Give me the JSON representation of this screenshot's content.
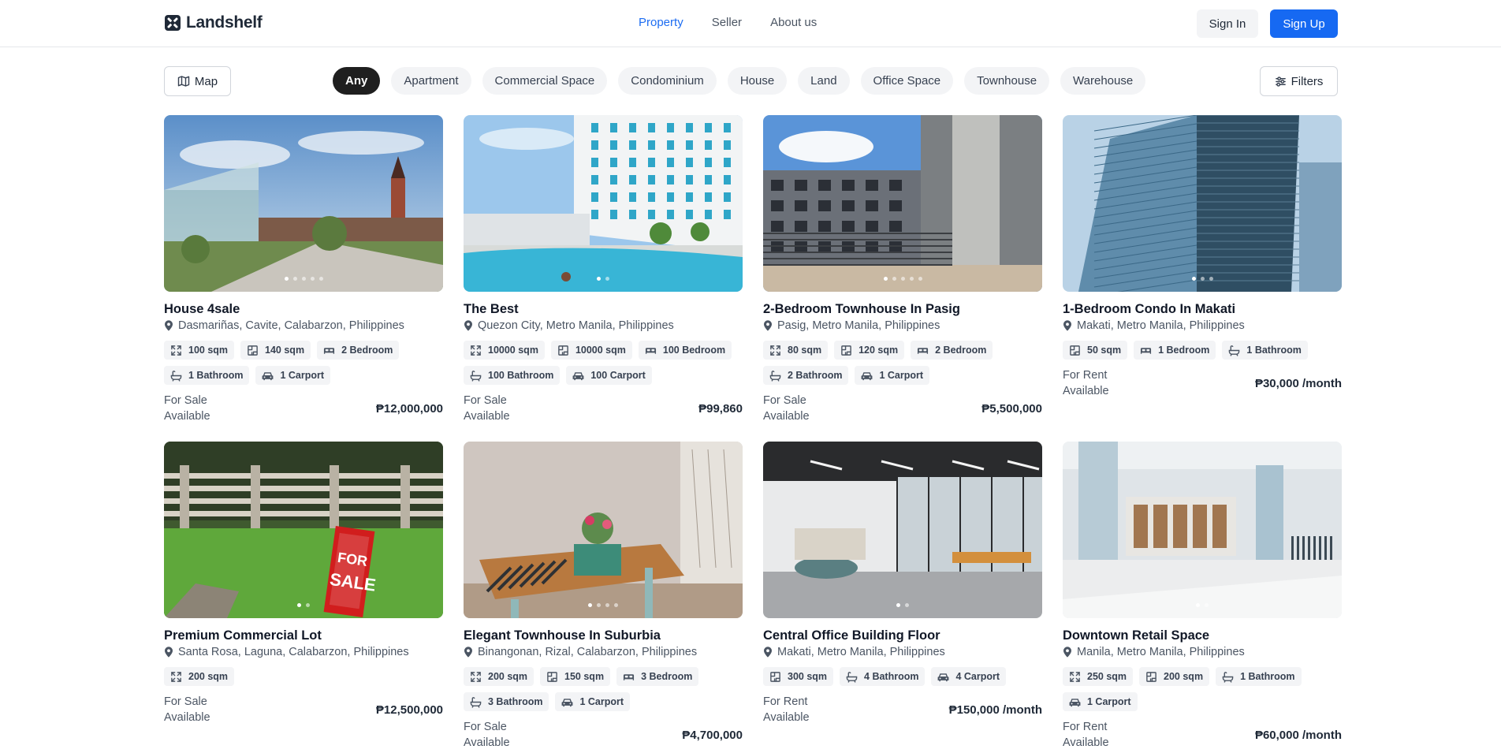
{
  "brand": {
    "name": "Landshelf"
  },
  "nav": [
    {
      "label": "Property",
      "active": true
    },
    {
      "label": "Seller",
      "active": false
    },
    {
      "label": "About us",
      "active": false
    }
  ],
  "auth": {
    "sign_in": "Sign In",
    "sign_up": "Sign Up"
  },
  "toolbar": {
    "map_label": "Map",
    "filters_label": "Filters"
  },
  "categories": [
    "Any",
    "Apartment",
    "Commercial Space",
    "Condominium",
    "House",
    "Land",
    "Office Space",
    "Townhouse",
    "Warehouse"
  ],
  "active_category": "Any",
  "colors": {
    "accent": "#1669f2",
    "nav_active": "#1d6df2",
    "chip_active": "#1f1f1f"
  },
  "listings": [
    {
      "title": "House 4sale",
      "location": "Dasmariñas, Cavite, Calabarzon, Philippines",
      "tags": [
        {
          "icon": "area-icon",
          "label": "100 sqm"
        },
        {
          "icon": "floor-plan-icon",
          "label": "140 sqm"
        },
        {
          "icon": "bed-icon",
          "label": "2 Bedroom"
        },
        {
          "icon": "bath-icon",
          "label": "1 Bathroom"
        },
        {
          "icon": "car-icon",
          "label": "1 Carport"
        }
      ],
      "type": "For Sale",
      "availability": "Available",
      "price": "₱12,000,000",
      "image_dots": 5,
      "active_dot": 0
    },
    {
      "title": "The Best",
      "location": "Quezon City, Metro Manila, Philippines",
      "tags": [
        {
          "icon": "area-icon",
          "label": "10000 sqm"
        },
        {
          "icon": "floor-plan-icon",
          "label": "10000 sqm"
        },
        {
          "icon": "bed-icon",
          "label": "100 Bedroom"
        },
        {
          "icon": "bath-icon",
          "label": "100 Bathroom"
        },
        {
          "icon": "car-icon",
          "label": "100 Carport"
        }
      ],
      "type": "For Sale",
      "availability": "Available",
      "price": "₱99,860",
      "image_dots": 2,
      "active_dot": 0
    },
    {
      "title": "2-Bedroom Townhouse In Pasig",
      "location": "Pasig, Metro Manila, Philippines",
      "tags": [
        {
          "icon": "area-icon",
          "label": "80 sqm"
        },
        {
          "icon": "floor-plan-icon",
          "label": "120 sqm"
        },
        {
          "icon": "bed-icon",
          "label": "2 Bedroom"
        },
        {
          "icon": "bath-icon",
          "label": "2 Bathroom"
        },
        {
          "icon": "car-icon",
          "label": "1 Carport"
        }
      ],
      "type": "For Sale",
      "availability": "Available",
      "price": "₱5,500,000",
      "image_dots": 5,
      "active_dot": 0
    },
    {
      "title": "1-Bedroom Condo In Makati",
      "location": "Makati, Metro Manila, Philippines",
      "tags": [
        {
          "icon": "floor-plan-icon",
          "label": "50 sqm"
        },
        {
          "icon": "bed-icon",
          "label": "1 Bedroom"
        },
        {
          "icon": "bath-icon",
          "label": "1 Bathroom"
        }
      ],
      "type": "For Rent",
      "availability": "Available",
      "price": "₱30,000 /month",
      "image_dots": 3,
      "active_dot": 0
    },
    {
      "title": "Premium Commercial Lot",
      "location": "Santa Rosa, Laguna, Calabarzon, Philippines",
      "tags": [
        {
          "icon": "area-icon",
          "label": "200 sqm"
        }
      ],
      "type": "For Sale",
      "availability": "Available",
      "price": "₱12,500,000",
      "image_dots": 2,
      "active_dot": 0
    },
    {
      "title": "Elegant Townhouse In Suburbia",
      "location": "Binangonan, Rizal, Calabarzon, Philippines",
      "tags": [
        {
          "icon": "area-icon",
          "label": "200 sqm"
        },
        {
          "icon": "floor-plan-icon",
          "label": "150 sqm"
        },
        {
          "icon": "bed-icon",
          "label": "3 Bedroom"
        },
        {
          "icon": "bath-icon",
          "label": "3 Bathroom"
        },
        {
          "icon": "car-icon",
          "label": "1 Carport"
        }
      ],
      "type": "For Sale",
      "availability": "Available",
      "price": "₱4,700,000",
      "image_dots": 4,
      "active_dot": 0
    },
    {
      "title": "Central Office Building Floor",
      "location": "Makati, Metro Manila, Philippines",
      "tags": [
        {
          "icon": "floor-plan-icon",
          "label": "300 sqm"
        },
        {
          "icon": "bath-icon",
          "label": "4 Bathroom"
        },
        {
          "icon": "car-icon",
          "label": "4 Carport"
        }
      ],
      "type": "For Rent",
      "availability": "Available",
      "price": "₱150,000 /month",
      "image_dots": 2,
      "active_dot": 0
    },
    {
      "title": "Downtown Retail Space",
      "location": "Manila, Metro Manila, Philippines",
      "tags": [
        {
          "icon": "area-icon",
          "label": "250 sqm"
        },
        {
          "icon": "floor-plan-icon",
          "label": "200 sqm"
        },
        {
          "icon": "bath-icon",
          "label": "1 Bathroom"
        },
        {
          "icon": "car-icon",
          "label": "1 Carport"
        }
      ],
      "type": "For Rent",
      "availability": "Available",
      "price": "₱60,000 /month",
      "image_dots": 2,
      "active_dot": 0
    }
  ]
}
